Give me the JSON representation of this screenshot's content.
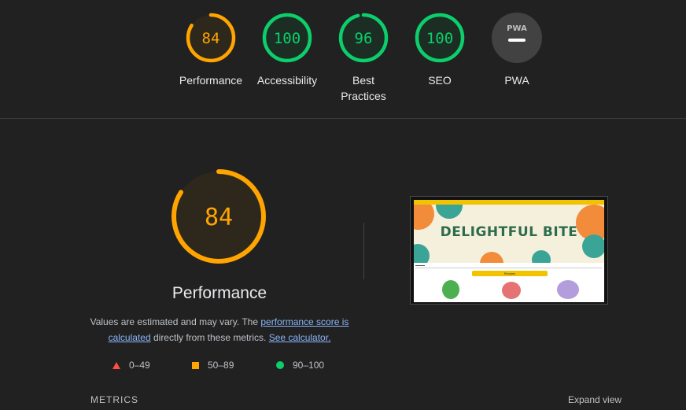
{
  "colors": {
    "pass": "#0cce6b",
    "average": "#ffa400",
    "fail": "#ff4e42",
    "na": "#9e9e9e"
  },
  "gauges": [
    {
      "label": "Performance",
      "score": 84,
      "rating": "average"
    },
    {
      "label": "Accessibility",
      "score": 100,
      "rating": "pass"
    },
    {
      "label": "Best Practices",
      "score": 96,
      "rating": "pass"
    },
    {
      "label": "SEO",
      "score": 100,
      "rating": "pass"
    },
    {
      "label": "PWA",
      "badge": "PWA",
      "rating": "na"
    }
  ],
  "performance": {
    "score": 84,
    "title": "Performance",
    "desc_prefix": "Values are estimated and may vary. The ",
    "link_score": "performance score is calculated",
    "desc_middle": " directly from these metrics. ",
    "link_calc": "See calculator."
  },
  "legend": [
    {
      "shape": "triangle",
      "range": "0–49"
    },
    {
      "shape": "square",
      "range": "50–89"
    },
    {
      "shape": "circle",
      "range": "90–100"
    }
  ],
  "screenshot": {
    "site_title": "DELIGHTFUL BITE",
    "button_label": "Recipes"
  },
  "metrics": {
    "label": "METRICS",
    "expand": "Expand view"
  }
}
